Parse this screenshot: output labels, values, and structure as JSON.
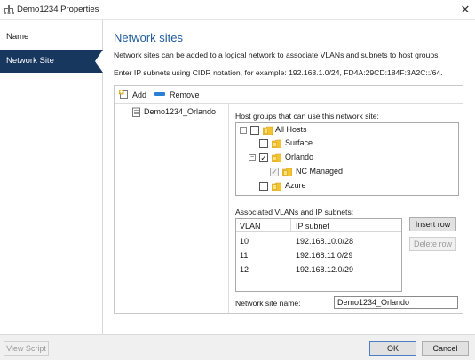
{
  "window": {
    "title": "Demo1234 Properties",
    "close_glyph": "✕",
    "app_icon": "network-icon"
  },
  "sidebar": {
    "items": [
      {
        "label": "Name",
        "active": false
      },
      {
        "label": "Network Site",
        "active": true
      }
    ]
  },
  "main": {
    "heading": "Network sites",
    "description": "Network sites can be added to a logical network to associate VLANs and subnets to host groups.",
    "hint": "Enter IP subnets using CIDR notation, for example: 192.168.1.0/24, FD4A:29CD:184F:3A2C::/64."
  },
  "toolbar": {
    "add_label": "Add",
    "remove_label": "Remove"
  },
  "sites": [
    {
      "label": "Demo1234_Orlando",
      "selected": true
    }
  ],
  "host_groups": {
    "label": "Host groups that can use this network site:",
    "tree": [
      {
        "label": "All Hosts",
        "expander": "⊟",
        "checked": false,
        "disabled": false
      },
      {
        "label": "Surface",
        "expander": "",
        "checked": false,
        "disabled": false
      },
      {
        "label": "Orlando",
        "expander": "⊟",
        "checked": true,
        "disabled": false
      },
      {
        "label": "NC Managed",
        "expander": "",
        "checked": true,
        "disabled": true
      },
      {
        "label": "Azure",
        "expander": "",
        "checked": false,
        "disabled": false
      }
    ],
    "check_glyph": "✓"
  },
  "vlans": {
    "label": "Associated VLANs and IP subnets:",
    "columns": [
      "VLAN",
      "IP subnet"
    ],
    "rows": [
      {
        "vlan": "10",
        "subnet": "192.168.10.0/28"
      },
      {
        "vlan": "11",
        "subnet": "192.168.11.0/29"
      },
      {
        "vlan": "12",
        "subnet": "192.168.12.0/29"
      }
    ],
    "insert_label": "Insert row",
    "delete_label": "Delete row"
  },
  "site_name": {
    "label": "Network site name:",
    "value": "Demo1234_Orlando"
  },
  "footer": {
    "view_script": "View Script",
    "ok": "OK",
    "cancel": "Cancel"
  },
  "colors": {
    "accent": "#17375f",
    "heading": "#1f5b9e",
    "remove_icon": "#2b7fd4",
    "folder": "#f4c430"
  }
}
